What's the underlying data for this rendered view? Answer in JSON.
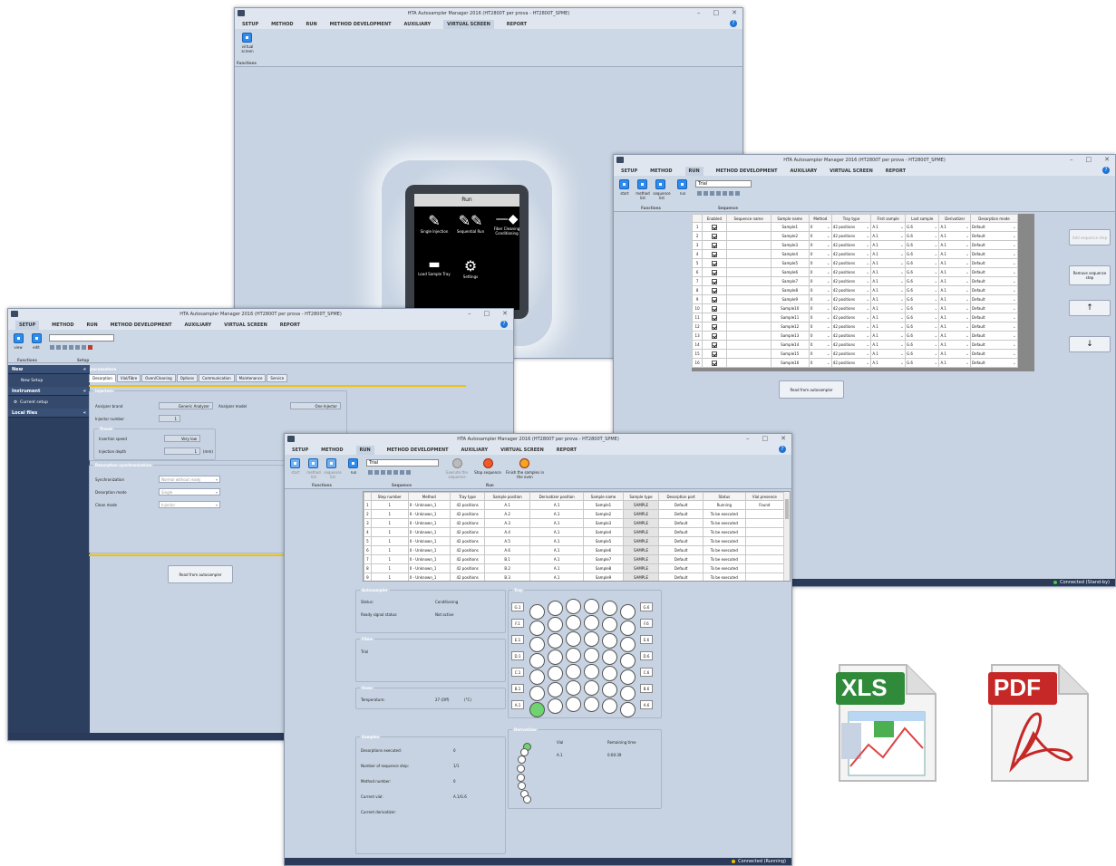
{
  "bg_window": {
    "title": "HTA Autosampler Manager 2016 (HT2800T per prova - HT2800T_SPME)",
    "menu": [
      "SETUP",
      "METHOD",
      "RUN",
      "METHOD DEVELOPMENT",
      "AUXILIARY",
      "VIRTUAL SCREEN",
      "REPORT"
    ],
    "active_menu": "VIRTUAL SCREEN",
    "ribbon_btn": "virtual screen",
    "ribbon_group": "Functions",
    "screen": {
      "title": "Run",
      "items": [
        "Single Injection",
        "Sequential Run",
        "Fiber Cleaning Conditioning",
        "Load Sample Tray",
        "Settings"
      ]
    }
  },
  "run_window": {
    "title": "HTA Autosampler Manager 2016 (HT2800T per prova - HT2800T_SPME)",
    "menu": [
      "SETUP",
      "METHOD",
      "RUN",
      "METHOD DEVELOPMENT",
      "AUXILIARY",
      "VIRTUAL SCREEN",
      "REPORT"
    ],
    "active_menu": "RUN",
    "input": "Trial",
    "buttons": [
      "start",
      "method list",
      "sequence list",
      "run"
    ],
    "groups": [
      "Functions",
      "Sequence"
    ],
    "columns": [
      "",
      "Enabled",
      "Sequence name",
      "Sample name",
      "Method",
      "Tray type",
      "First sample",
      "Last sample",
      "Derivatizer",
      "Desorption mode"
    ],
    "rows": [
      [
        "1",
        "",
        "Sample1",
        "0",
        "42 positions",
        "A.1",
        "G.6",
        "A.1",
        "Default"
      ],
      [
        "2",
        "",
        "Sample2",
        "0",
        "42 positions",
        "A.1",
        "G.6",
        "A.1",
        "Default"
      ],
      [
        "3",
        "",
        "Sample3",
        "0",
        "42 positions",
        "A.1",
        "G.6",
        "A.1",
        "Default"
      ],
      [
        "4",
        "",
        "Sample4",
        "0",
        "42 positions",
        "A.1",
        "G.6",
        "A.1",
        "Default"
      ],
      [
        "5",
        "",
        "Sample5",
        "0",
        "42 positions",
        "A.1",
        "G.6",
        "A.1",
        "Default"
      ],
      [
        "6",
        "",
        "Sample6",
        "0",
        "42 positions",
        "A.1",
        "G.6",
        "A.1",
        "Default"
      ],
      [
        "7",
        "",
        "Sample7",
        "0",
        "42 positions",
        "A.1",
        "G.6",
        "A.1",
        "Default"
      ],
      [
        "8",
        "",
        "Sample8",
        "0",
        "42 positions",
        "A.1",
        "G.6",
        "A.1",
        "Default"
      ],
      [
        "9",
        "",
        "Sample9",
        "0",
        "42 positions",
        "A.1",
        "G.6",
        "A.1",
        "Default"
      ],
      [
        "10",
        "",
        "Sample10",
        "0",
        "42 positions",
        "A.1",
        "G.6",
        "A.1",
        "Default"
      ],
      [
        "11",
        "",
        "Sample11",
        "0",
        "42 positions",
        "A.1",
        "G.6",
        "A.1",
        "Default"
      ],
      [
        "12",
        "",
        "Sample12",
        "0",
        "42 positions",
        "A.1",
        "G.6",
        "A.1",
        "Default"
      ],
      [
        "13",
        "",
        "Sample13",
        "0",
        "42 positions",
        "A.1",
        "G.6",
        "A.1",
        "Default"
      ],
      [
        "14",
        "",
        "Sample14",
        "0",
        "42 positions",
        "A.1",
        "G.6",
        "A.1",
        "Default"
      ],
      [
        "15",
        "",
        "Sample15",
        "0",
        "42 positions",
        "A.1",
        "G.6",
        "A.1",
        "Default"
      ],
      [
        "16",
        "",
        "Sample16",
        "0",
        "42 positions",
        "A.1",
        "G.6",
        "A.1",
        "Default"
      ]
    ],
    "side_buttons": [
      "Add sequence step",
      "Remove sequence step",
      "↑",
      "↓"
    ],
    "read_btn": "Read from autosampler",
    "status": "Connected (Stand-by)",
    "status_color": "#3dd13d"
  },
  "setup_window": {
    "title": "HTA Autosampler Manager 2016 (HT2800T per prova - HT2800T_SPME)",
    "menu": [
      "SETUP",
      "METHOD",
      "RUN",
      "METHOD DEVELOPMENT",
      "AUXILIARY",
      "VIRTUAL SCREEN",
      "REPORT"
    ],
    "active_menu": "SETUP",
    "buttons": [
      "view",
      "edit"
    ],
    "groups": [
      "Functions",
      "Setup"
    ],
    "nav": {
      "new": "New",
      "new_setup": "New Setup",
      "instrument": "Instrument",
      "current_setup": "Current setup",
      "local_files": "Local files"
    },
    "params_title": "parameters",
    "tabs": [
      "Desorption",
      "Vial/Fibre",
      "Oven/Cleaning",
      "Options",
      "Communication",
      "Maintenance",
      "Service"
    ],
    "injectors_legend": "Injectors",
    "analyzer_brand_lbl": "Analyzer brand",
    "analyzer_brand": "Generic Analyzer",
    "analyzer_model_lbl": "Analyzer model",
    "analyzer_model": "One Injector",
    "injector_number_lbl": "Injector number",
    "injector_number": "1",
    "travel_legend": "Travel",
    "insertion_speed_lbl": "Insertion speed",
    "insertion_speed": "Very low",
    "injection_depth_lbl": "Injection depth",
    "injection_depth": "1",
    "injection_depth_unit": "(mm)",
    "desync_legend": "Desorption synchronization",
    "sync_lbl": "Synchronization",
    "sync": "Normal without ready",
    "desmode_lbl": "Desorption mode",
    "desmode": "Single",
    "clean_lbl": "Clean mode",
    "clean": "Injector",
    "read_btn": "Read from autosampler"
  },
  "main_window": {
    "title": "HTA Autosampler Manager 2016 (HT2800T per prova - HT2800T_SPME)",
    "menu": [
      "SETUP",
      "METHOD",
      "RUN",
      "METHOD DEVELOPMENT",
      "AUXILIARY",
      "VIRTUAL SCREEN",
      "REPORT"
    ],
    "active_menu": "RUN",
    "input": "Trial",
    "buttons": [
      "start",
      "method list",
      "sequence list",
      "run"
    ],
    "run_buttons": [
      "Execute the sequence",
      "Stop sequence",
      "Finish the samples in the oven"
    ],
    "groups": [
      "Functions",
      "Sequence",
      "Run"
    ],
    "columns": [
      "",
      "Step number",
      "Method",
      "Tray type",
      "Sample position",
      "Derivatizer position",
      "Sample name",
      "Sample type",
      "Desorption port",
      "Status",
      "Vial presence"
    ],
    "rows": [
      [
        "1",
        "0 - Unknown_1",
        "42 positions",
        "A.1",
        "A.1",
        "Sample1",
        "SAMPLE",
        "Default",
        "Running",
        "Found"
      ],
      [
        "1",
        "0 - Unknown_1",
        "42 positions",
        "A.2",
        "A.1",
        "Sample2",
        "SAMPLE",
        "Default",
        "To be executed",
        ""
      ],
      [
        "1",
        "0 - Unknown_1",
        "42 positions",
        "A.3",
        "A.1",
        "Sample3",
        "SAMPLE",
        "Default",
        "To be executed",
        ""
      ],
      [
        "1",
        "0 - Unknown_1",
        "42 positions",
        "A.4",
        "A.1",
        "Sample4",
        "SAMPLE",
        "Default",
        "To be executed",
        ""
      ],
      [
        "1",
        "0 - Unknown_1",
        "42 positions",
        "A.5",
        "A.1",
        "Sample5",
        "SAMPLE",
        "Default",
        "To be executed",
        ""
      ],
      [
        "1",
        "0 - Unknown_1",
        "42 positions",
        "A.6",
        "A.1",
        "Sample6",
        "SAMPLE",
        "Default",
        "To be executed",
        ""
      ],
      [
        "1",
        "0 - Unknown_1",
        "42 positions",
        "B.1",
        "A.1",
        "Sample7",
        "SAMPLE",
        "Default",
        "To be executed",
        ""
      ],
      [
        "1",
        "0 - Unknown_1",
        "42 positions",
        "B.2",
        "A.1",
        "Sample8",
        "SAMPLE",
        "Default",
        "To be executed",
        ""
      ],
      [
        "1",
        "0 - Unknown_1",
        "42 positions",
        "B.3",
        "A.1",
        "Sample9",
        "SAMPLE",
        "Default",
        "To be executed",
        ""
      ]
    ],
    "row_nums": [
      "1",
      "2",
      "3",
      "4",
      "5",
      "6",
      "7",
      "8",
      "9"
    ],
    "autosampler_legend": "Autosampler",
    "status_lbl": "Status:",
    "status_val": "Conditioning",
    "ready_lbl": "Ready signal status:",
    "ready_val": "Not active",
    "fibre_legend": "Fibre",
    "fibre_lbl": "Trial",
    "oven_legend": "Oven",
    "temp_lbl": "Temperature:",
    "temp_val": "27 (Off)",
    "temp_unit": "(°C)",
    "samples_legend": "Samples",
    "desorptions_lbl": "Desorptions executed:",
    "desorptions_val": "0",
    "seqstep_lbl": "Number of sequence step:",
    "seqstep_val": "1/1",
    "method_lbl": "Method number:",
    "method_val": "0",
    "curvial_lbl": "Current vial:",
    "curvial_val": "A.1/G.6",
    "curderiv_lbl": "Current derivatizer:",
    "tray_legend": "Tray",
    "tray_rows": [
      "G",
      "F",
      "E",
      "D",
      "C",
      "B",
      "A"
    ],
    "deriv_legend": "Derivatizer",
    "vial_hdr": "Vial",
    "remaining_hdr": "Remaining time",
    "vial_val": "A.1",
    "remaining_val": "0:00:39",
    "status": "Connected (Running)",
    "status_color": "#f2c200"
  },
  "files": {
    "xls": "XLS",
    "pdf": "PDF"
  }
}
